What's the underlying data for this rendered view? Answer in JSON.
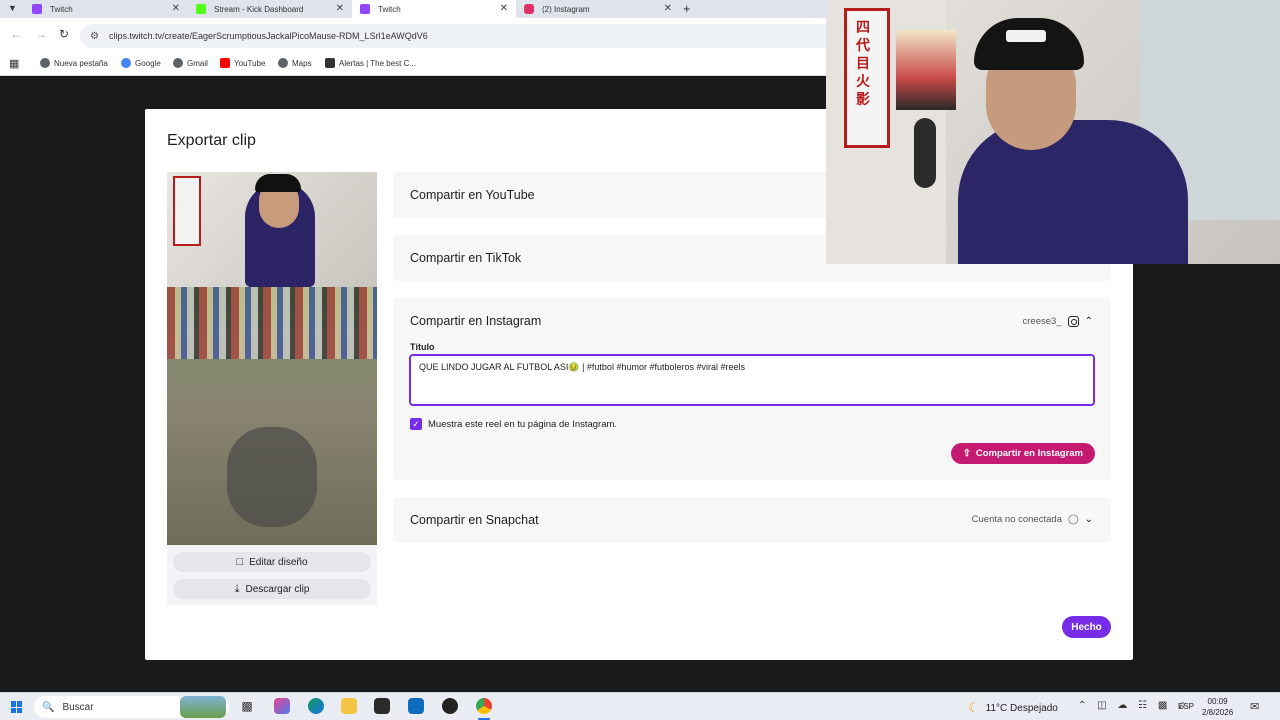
{
  "browser": {
    "tabs": [
      {
        "title": "Twitch",
        "color": "#9146ff"
      },
      {
        "title": "Stream - Kick Dashboard",
        "color": "#53fc18"
      },
      {
        "title": "Twitch",
        "color": "#9146ff"
      },
      {
        "title": "(2) Instagram",
        "color": "#e1306c"
      }
    ],
    "new_tab_symbol": "+",
    "url": "clips.twitch.tv/create/EagerScrumptiousJackalPicoMause-RDM_LSrl1eAWQdV6",
    "bookmarks": [
      "Nueva pestaña",
      "Google",
      "Gmail",
      "YouTube",
      "Maps",
      "Alertas | The best C..."
    ]
  },
  "modal": {
    "title": "Exportar clip",
    "edit_layout_label": "Editar diseño",
    "download_label": "Descargar clip",
    "youtube": {
      "title": "Compartir en YouTube"
    },
    "tiktok": {
      "title": "Compartir en TikTok"
    },
    "instagram": {
      "title": "Compartir en Instagram",
      "account": "creese3_",
      "field_label": "Título",
      "caption": "QUE LINDO JUGAR AL FUTBOL ASI🤢 | #futbol #humor #futboleros #viral #reels",
      "checkbox_label": "Muestra este reel en tu página de Instagram.",
      "checkbox_checked": true,
      "share_button": "Compartir en Instagram",
      "accent": "#c41a72"
    },
    "snapchat": {
      "title": "Compartir en Snapchat",
      "status": "Cuenta no conectada"
    },
    "done_button": "Hecho",
    "accent": "#772ce8"
  },
  "webcam": {
    "banner_text": "四代目火影"
  },
  "taskbar": {
    "search_placeholder": "Buscar",
    "weather": "11°C Despejado",
    "language": "ESP",
    "time": "00:09",
    "date": "2/8/2026"
  }
}
